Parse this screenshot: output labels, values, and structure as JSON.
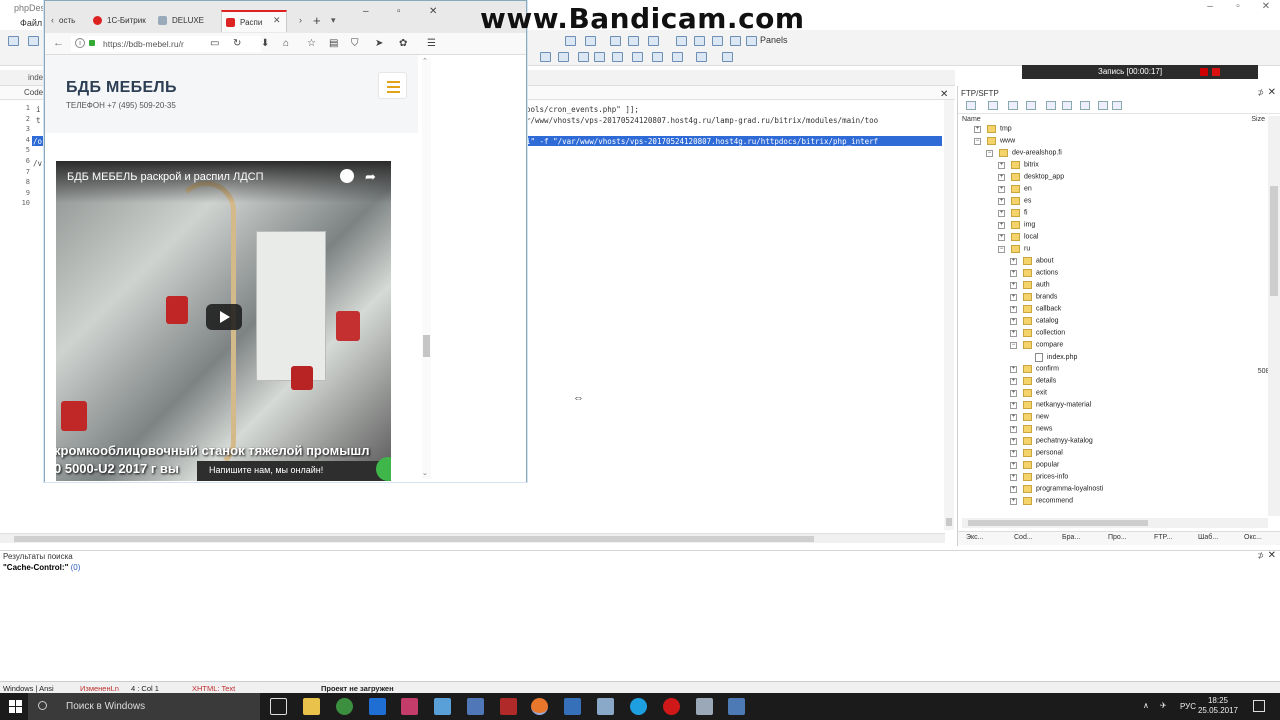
{
  "watermark": "www.Bandicam.com",
  "ide": {
    "title": "phpDes",
    "menu_file": "Файл",
    "panels_label": "Panels",
    "record_text": "Запись [00:00:17]",
    "file_tab": "inde",
    "code_tab": "Code",
    "line_numbers": [
      "1",
      "2",
      "3",
      "4",
      "5",
      "6",
      "7",
      "8",
      "9",
      "10"
    ],
    "code_line1": "ools/cron_events.php\" ]];",
    "code_line2": "r/www/vhosts/vps-20170524120807.host4g.ru/lamp-grad.ru/bitrix/modules/main/too",
    "code_line4": "i\" -f \"/var/www/vhosts/vps-20170524120807.host4g.ru/httpdocs/bitrix/php_interf",
    "code_lead1": "i",
    "code_lead2": "t",
    "code_lead4": "/o",
    "code_lead6": "/v"
  },
  "ftp": {
    "title": "FTP/SFTP",
    "col_name": "Name",
    "col_size": "Size",
    "file_size": "508 B",
    "tree": [
      {
        "label": "php-bin",
        "depth": 2,
        "exp": "+"
      },
      {
        "label": "tmp",
        "depth": 2,
        "exp": "+"
      },
      {
        "label": "www",
        "depth": 2,
        "exp": "−"
      },
      {
        "label": "dev-arealshop.fi",
        "depth": 3,
        "exp": "−"
      },
      {
        "label": "bitrix",
        "depth": 4,
        "exp": "+"
      },
      {
        "label": "desktop_app",
        "depth": 4,
        "exp": "+"
      },
      {
        "label": "en",
        "depth": 4,
        "exp": "+"
      },
      {
        "label": "es",
        "depth": 4,
        "exp": "+"
      },
      {
        "label": "fi",
        "depth": 4,
        "exp": "+"
      },
      {
        "label": "img",
        "depth": 4,
        "exp": "+"
      },
      {
        "label": "local",
        "depth": 4,
        "exp": "+"
      },
      {
        "label": "ru",
        "depth": 4,
        "exp": "−"
      },
      {
        "label": "about",
        "depth": 5,
        "exp": "+"
      },
      {
        "label": "actions",
        "depth": 5,
        "exp": "+"
      },
      {
        "label": "auth",
        "depth": 5,
        "exp": "+"
      },
      {
        "label": "brands",
        "depth": 5,
        "exp": "+"
      },
      {
        "label": "callback",
        "depth": 5,
        "exp": "+"
      },
      {
        "label": "catalog",
        "depth": 5,
        "exp": "+"
      },
      {
        "label": "collection",
        "depth": 5,
        "exp": "+"
      },
      {
        "label": "compare",
        "depth": 5,
        "exp": "−"
      },
      {
        "label": "index.php",
        "depth": 6,
        "exp": "",
        "file": true
      },
      {
        "label": "confirm",
        "depth": 5,
        "exp": "+"
      },
      {
        "label": "details",
        "depth": 5,
        "exp": "+"
      },
      {
        "label": "exit",
        "depth": 5,
        "exp": "+"
      },
      {
        "label": "netkanyy-material",
        "depth": 5,
        "exp": "+"
      },
      {
        "label": "new",
        "depth": 5,
        "exp": "+"
      },
      {
        "label": "news",
        "depth": 5,
        "exp": "+"
      },
      {
        "label": "pechatnyy-katalog",
        "depth": 5,
        "exp": "+"
      },
      {
        "label": "personal",
        "depth": 5,
        "exp": "+"
      },
      {
        "label": "popular",
        "depth": 5,
        "exp": "+"
      },
      {
        "label": "prices-info",
        "depth": 5,
        "exp": "+"
      },
      {
        "label": "programma-loyalnosti",
        "depth": 5,
        "exp": "+"
      },
      {
        "label": "recommend",
        "depth": 5,
        "exp": "+"
      }
    ],
    "tabs": [
      "Экс...",
      "Cod...",
      "Бра...",
      "Про...",
      "FTP...",
      "Шаб...",
      "Окс..."
    ]
  },
  "results": {
    "title": "Результаты поиска",
    "query": "\"Cache-Control:\"",
    "count": "(0)"
  },
  "status": {
    "encoding": "Windows | Ansi",
    "modified": "ИзмененLn",
    "position": "4 : Col 1",
    "mode": "XHTML: Text",
    "project": "Проект не загружен"
  },
  "taskbar": {
    "search_placeholder": "Поиск в Windows",
    "lang": "РУС",
    "time": "18:25",
    "date": "25.05.2017"
  },
  "browser": {
    "tab_partial": "ость",
    "tab1": "1С-Битрик",
    "tab2": "DELUXE",
    "tab3": "Распи",
    "url": "https://bdb-mebel.ru/r",
    "site_logo": "БДБ МЕБЕЛЬ",
    "site_phone": "ТЕЛЕФОН +7 (495) 509-20-35",
    "video_title": "БДБ МЕБЕЛЬ раскрой и распил ЛДСП",
    "video_caption1": "кромкооблицовочный станок тяжелой промышл",
    "video_caption2": "0 5000-U2 2017 г вы",
    "chat_text": "Напишите нам, мы онлайн!"
  },
  "colors": {
    "selection": "#2f6bd6",
    "logo_text": "#2e3f55",
    "burger": "#e2a21a",
    "chat_green": "#3fb64a",
    "taskbar": "#1b1b1b"
  }
}
